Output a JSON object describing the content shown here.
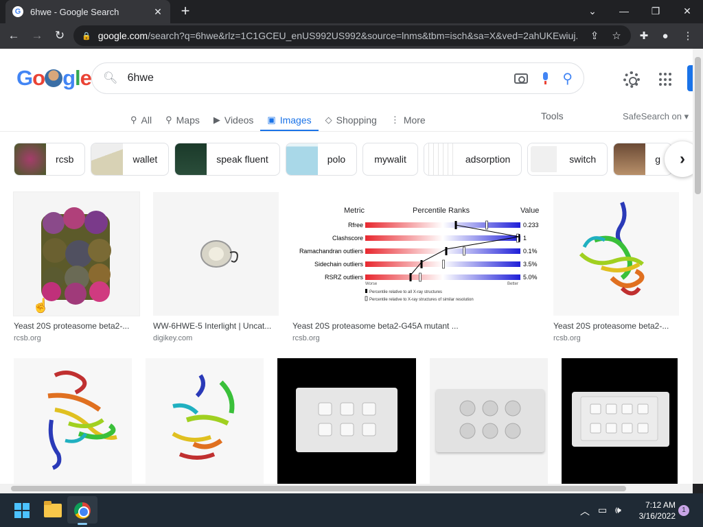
{
  "browser": {
    "tab_title": "6hwe - Google Search",
    "favicon": "G",
    "url_domain": "google.com",
    "url_path": "/search?q=6hwe&rlz=1C1GCEU_enUS992US992&source=lnms&tbm=isch&sa=X&ved=2ahUKEwiuj..."
  },
  "search": {
    "query": "6hwe"
  },
  "logo": {
    "letters": [
      "G",
      "o",
      "",
      "g",
      "l",
      "e"
    ],
    "colors": [
      "#4285f4",
      "#ea4335",
      "#fbbc05",
      "#4285f4",
      "#34a853",
      "#ea4335"
    ]
  },
  "nav_tabs": [
    {
      "label": "All",
      "icon": "search-icon"
    },
    {
      "label": "Maps",
      "icon": "map-pin-icon"
    },
    {
      "label": "Videos",
      "icon": "play-icon"
    },
    {
      "label": "Images",
      "icon": "image-icon"
    },
    {
      "label": "Shopping",
      "icon": "tag-icon"
    },
    {
      "label": "More",
      "icon": "more-vert-icon"
    }
  ],
  "tools_label": "Tools",
  "safesearch_label": "SafeSearch on",
  "chips": [
    {
      "label": "rcsb"
    },
    {
      "label": "wallet"
    },
    {
      "label": "speak fluent"
    },
    {
      "label": "polo"
    },
    {
      "label": "mywalit"
    },
    {
      "label": "adsorption"
    },
    {
      "label": "switch"
    },
    {
      "label": "g"
    }
  ],
  "results": [
    {
      "title": "Yeast 20S proteasome beta2-...",
      "source": "rcsb.org"
    },
    {
      "title": "WW-6HWE-5 Interlight | Uncat...",
      "source": "digikey.com"
    },
    {
      "title": "Yeast 20S proteasome beta2-G45A mutant ...",
      "source": "rcsb.org"
    },
    {
      "title": "Yeast 20S proteasome beta2-...",
      "source": "rcsb.org"
    }
  ],
  "validation": {
    "metric_header": "Metric",
    "ranks_header": "Percentile Ranks",
    "value_header": "Value",
    "rows": [
      {
        "metric": "Rfree",
        "value": "0.233"
      },
      {
        "metric": "Clashscore",
        "value": "1"
      },
      {
        "metric": "Ramachandran outliers",
        "value": "0.1%"
      },
      {
        "metric": "Sidechain outliers",
        "value": "3.5%"
      },
      {
        "metric": "RSRZ outliers",
        "value": "5.0%"
      }
    ],
    "worse": "Worse",
    "better": "Better",
    "legend1": "Percentile relative to all X-ray structures",
    "legend2": "Percentile relative to X-ray structures of similar resolution"
  },
  "taskbar": {
    "time": "7:12 AM",
    "date": "3/16/2022",
    "notifications": "1"
  }
}
